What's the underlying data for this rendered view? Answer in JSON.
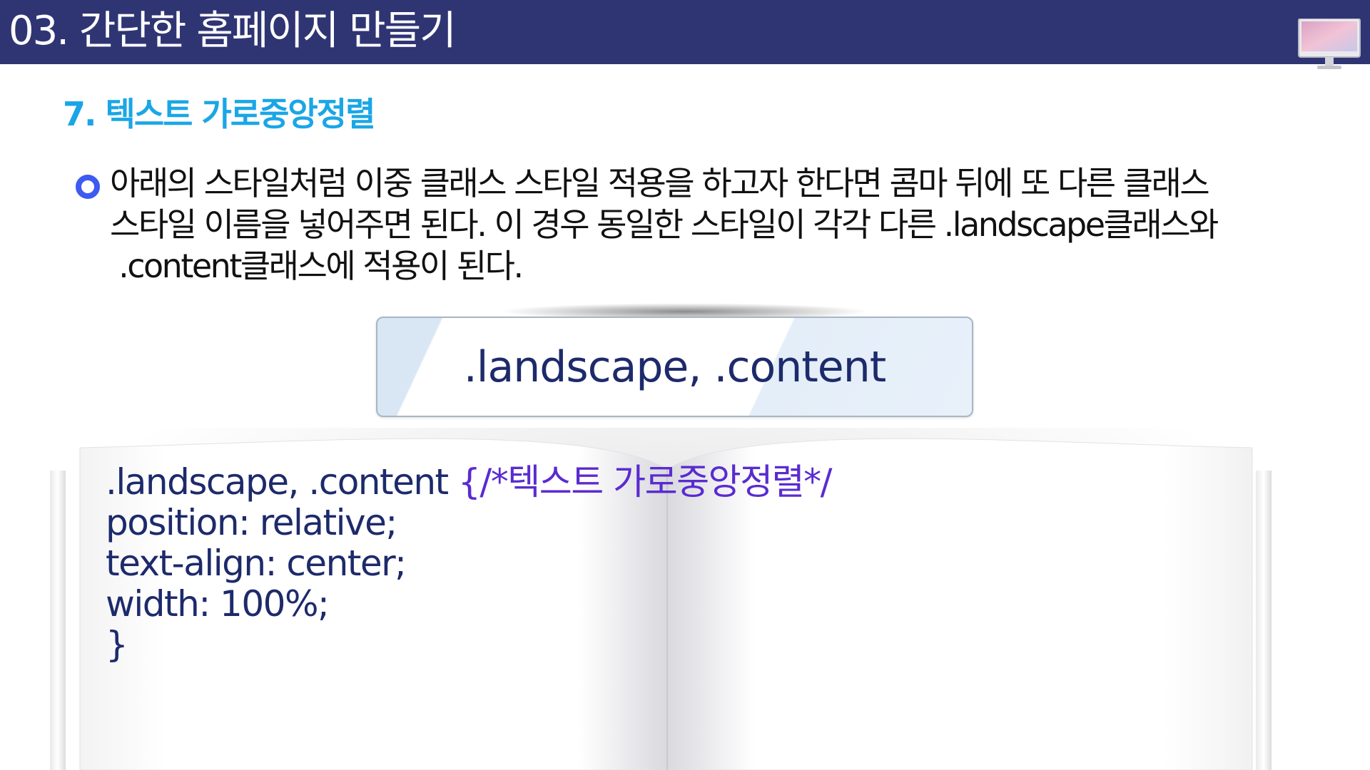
{
  "header": {
    "title": "03. 간단한 홈페이지 만들기",
    "icon": "monitor-icon",
    "background": "#2f3573"
  },
  "section": {
    "title": "7. 텍스트 가로중앙정렬",
    "color": "#1aa6e6"
  },
  "paragraph": {
    "lines": [
      "아래의 스타일처럼 이중 클래스 스타일 적용을 하고자 한다면 콤마 뒤에 또 다른 클래스",
      "스타일 이름을 넣어주면 된다. 이 경우 동일한 스타일이 각각 다른 .landscape클래스와",
      " .content클래스에 적용이 된다."
    ],
    "bullet_color": "#3d5bf0"
  },
  "selector_box": {
    "text": ".landscape, .content"
  },
  "code": {
    "selector": ".landscape, .content ",
    "comment": "{/*텍스트 가로중앙정렬*/",
    "lines": [
      "position: relative;",
      "text-align: center;",
      "width: 100%;",
      "}"
    ],
    "text_color": "#1d2a6b",
    "comment_color": "#5a2bd0"
  }
}
